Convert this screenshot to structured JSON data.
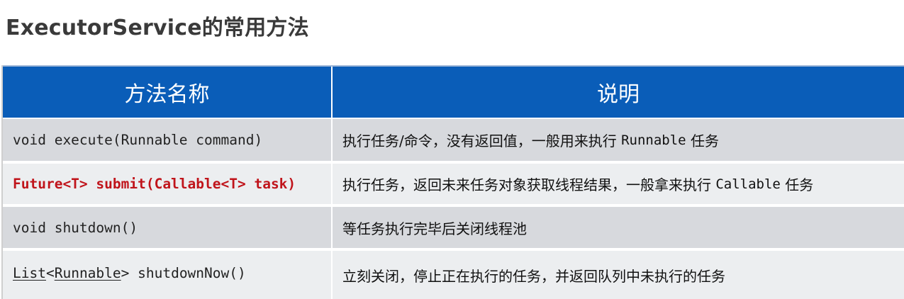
{
  "title": "ExecutorService的常用方法",
  "table": {
    "headers": [
      "方法名称",
      "说明"
    ],
    "rows": [
      {
        "method": "void execute(Runnable command)",
        "desc_pre": "执行任务/命令，没有返回值，一般用来执行 ",
        "desc_code": "Runnable",
        "desc_post": " 任务"
      },
      {
        "method": "Future<T> submit(Callable<T> task)",
        "desc_pre": "执行任务，返回未来任务对象获取线程结果，一般拿来执行 ",
        "desc_code": "Callable",
        "desc_post": " 任务"
      },
      {
        "method": "void shutdown()",
        "desc_pre": "等任务执行完毕后关闭线程池",
        "desc_code": "",
        "desc_post": ""
      },
      {
        "method_a": "List",
        "method_b": "<",
        "method_c": "Runnable",
        "method_d": "> shutdownNow()",
        "desc_pre": "立刻关闭，停止正在执行的任务，并返回队列中未执行的任务",
        "desc_code": "",
        "desc_post": ""
      }
    ]
  },
  "colors": {
    "header_bg": "#0a5db8",
    "row_dark": "#d7d9dd",
    "row_light": "#eceef0",
    "highlight": "#c0141b"
  }
}
